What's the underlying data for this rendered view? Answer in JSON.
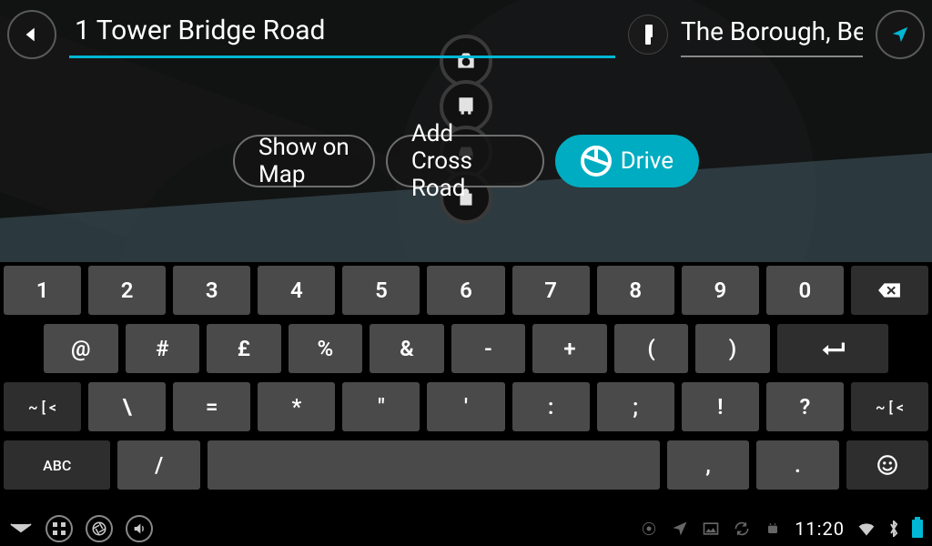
{
  "header": {
    "search_value": "1 Tower Bridge Road",
    "city_value": "The Borough, Ber"
  },
  "actions": {
    "show_on_map": "Show on Map",
    "add_cross_road": "Add Cross Road",
    "drive": "Drive"
  },
  "keyboard": {
    "row1": [
      "1",
      "2",
      "3",
      "4",
      "5",
      "6",
      "7",
      "8",
      "9",
      "0"
    ],
    "row2": [
      "@",
      "#",
      "£",
      "%",
      "&",
      "-",
      "+",
      "(",
      ")"
    ],
    "row3_outer": "~ [ <",
    "row3": [
      "\\",
      "=",
      "*",
      "\"",
      "'",
      ":",
      ";",
      "!",
      "?"
    ],
    "row4_left": "ABC",
    "row4_slash": "/",
    "row4_comma": ",",
    "row4_period": "."
  },
  "sysbar": {
    "clock": "11:20"
  },
  "poi_icons": [
    "camera",
    "bus",
    "car",
    "bag"
  ],
  "colors": {
    "accent": "#00b8d4"
  }
}
